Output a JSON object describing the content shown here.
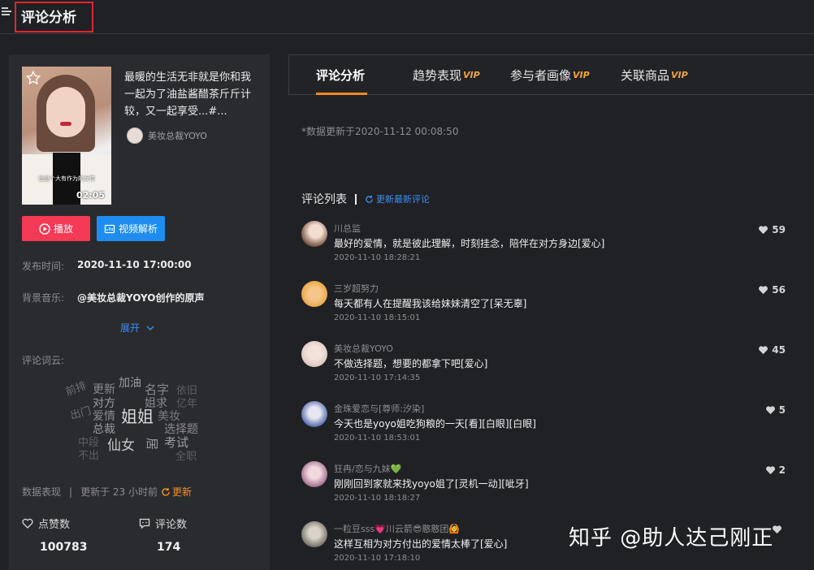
{
  "header": {
    "title": "评论分析"
  },
  "video": {
    "description": "最暖的生活无非就是你和我一起为了油盐酱醋茶斤斤计较，又一起享受...#...",
    "author": "美妆总裁YOYO",
    "cover_caption": "也是个大有作为的女性",
    "duration": "02:05"
  },
  "buttons": {
    "play": "播放",
    "parse": "视频解析"
  },
  "meta": {
    "publish_label": "发布时间:",
    "publish_value": "2020-11-10 17:00:00",
    "music_label": "背景音乐:",
    "music_value": "@美妆总裁YOYO创作的原声",
    "expand": "展开"
  },
  "word_cloud": {
    "label": "评论词云:",
    "words": [
      "前排",
      "更新",
      "加油",
      "名字",
      "依旧",
      "对方",
      "姐求",
      "亿年",
      "出门",
      "爱情",
      "姐姐",
      "美妆",
      "总裁",
      "选择题",
      "中段",
      "仙女",
      "考试",
      "不出",
      "全职",
      "居"
    ]
  },
  "data_status": {
    "label": "数据表现",
    "updated": "更新于 23 小时前",
    "refresh": "更新"
  },
  "stats": {
    "likes_label": "点赞数",
    "likes_value": "100783",
    "comments_label": "评论数",
    "comments_value": "174"
  },
  "tabs": [
    {
      "label": "评论分析",
      "vip": ""
    },
    {
      "label": "趋势表现",
      "vip": "VIP"
    },
    {
      "label": "参与者画像",
      "vip": "VIP"
    },
    {
      "label": "关联商品",
      "vip": "VIP"
    }
  ],
  "updated_note": "*数据更新于2020-11-12 00:08:50",
  "comment_list": {
    "title": "评论列表",
    "refresh": "更新最新评论",
    "items": [
      {
        "user": "川总监",
        "text": "最好的爱情，就是彼此理解，时刻挂念，陪伴在对方身边[爱心]",
        "time": "2020-11-10 18:28:21",
        "likes": "59"
      },
      {
        "user": "三岁超努力",
        "text": "每天都有人在提醒我该给妹妹清空了[呆无辜]",
        "time": "2020-11-10 18:15:01",
        "likes": "56"
      },
      {
        "user": "美妆总裁YOYO",
        "text": "不做选择题，想要的都拿下吧[爱心]",
        "time": "2020-11-10 17:14:35",
        "likes": "45"
      },
      {
        "user": "金珠爱恋与[尊师:汐染]",
        "text": "今天也是yoyo姐吃狗粮的一天[看][白眼][白眼]",
        "time": "2020-11-10 18:53:01",
        "likes": "5"
      },
      {
        "user": "狂冉/恋与九妹💚",
        "text": "刚刚回到家就来找yoyo姐了[灵机一动][呲牙]",
        "time": "2020-11-10 18:18:27",
        "likes": "2"
      },
      {
        "user": "一粒豆sss💗川云箭😎憨憨团🙆",
        "text": "这样互相为对方付出的爱情太棒了[爱心]",
        "time": "2020-11-10 17:18:10",
        "likes": ""
      }
    ]
  },
  "watermark": "知乎 @助人达己刚正",
  "colors": {
    "accent": "#f08a1e",
    "play": "#f43a54",
    "link": "#3a8ff5",
    "highlight_box": "#e0272a"
  }
}
